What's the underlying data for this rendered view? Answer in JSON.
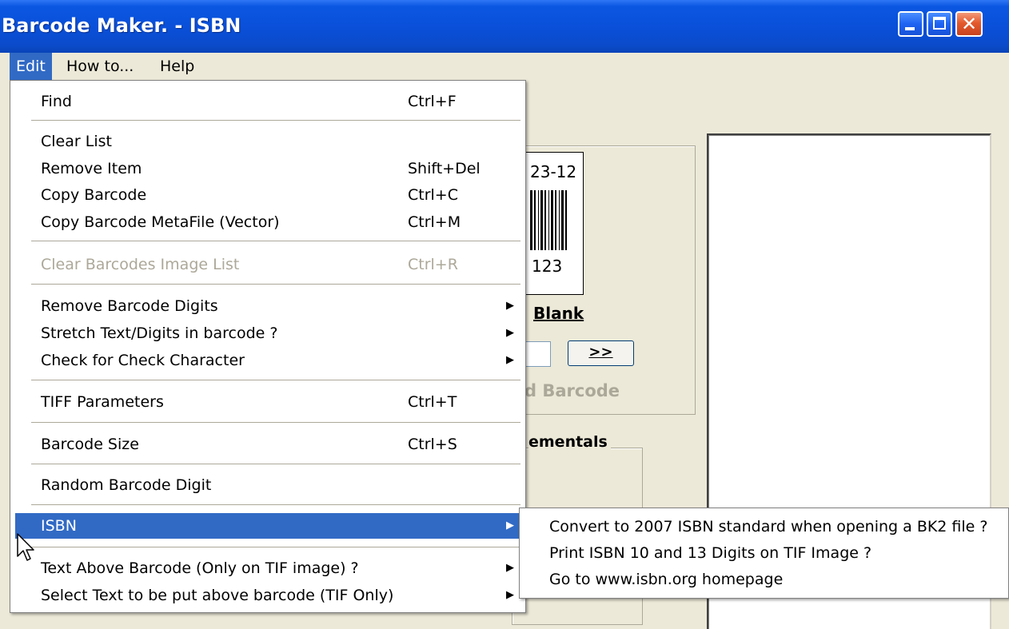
{
  "window": {
    "title": "Barcode Maker. - ISBN",
    "close_glyph": "✕"
  },
  "menubar": {
    "items": [
      {
        "label": "Edit",
        "active": true
      },
      {
        "label": "How to..."
      },
      {
        "label": "Help"
      }
    ]
  },
  "edit_menu": {
    "items": [
      {
        "label": "Find",
        "shortcut": "Ctrl+F"
      },
      {
        "label": "Clear List",
        "shortcut": ""
      },
      {
        "label": "Remove Item",
        "shortcut": "Shift+Del"
      },
      {
        "label": "Copy Barcode",
        "shortcut": "Ctrl+C"
      },
      {
        "label": "Copy Barcode MetaFile (Vector)",
        "shortcut": "Ctrl+M"
      },
      {
        "label": "Clear Barcodes Image List",
        "shortcut": "Ctrl+R",
        "disabled": true
      },
      {
        "label": "Remove Barcode Digits",
        "submenu": true
      },
      {
        "label": "Stretch Text/Digits in barcode ?",
        "submenu": true
      },
      {
        "label": "Check for Check Character",
        "submenu": true
      },
      {
        "label": "TIFF Parameters",
        "shortcut": "Ctrl+T"
      },
      {
        "label": "Barcode Size",
        "shortcut": "Ctrl+S"
      },
      {
        "label": "Random Barcode Digit",
        "shortcut": ""
      },
      {
        "label": "ISBN",
        "submenu": true,
        "highlighted": true
      },
      {
        "label": "Text Above Barcode (Only on TIF image) ?",
        "submenu": true
      },
      {
        "label": "Select Text to be put above barcode (TIF Only)",
        "submenu": true
      }
    ],
    "arrow_glyph": "▶"
  },
  "isbn_submenu": {
    "items": [
      {
        "label": "Convert to 2007 ISBN standard when opening a BK2 file ?"
      },
      {
        "label": "Print ISBN 10 and 13 Digits on TIF Image ?"
      },
      {
        "label": "Go to www.isbn.org homepage"
      }
    ]
  },
  "background": {
    "barcode_top_text": "23-12",
    "barcode_bottom_text": "123",
    "blank_prefix": "",
    "blank_label": "Blank",
    "next_button": ">>",
    "disabled_barcode_text": "d Barcode",
    "supplementals_label": "ementals"
  },
  "colors": {
    "titlebar": "#0A4FD8",
    "highlight": "#316AC5",
    "disabled": "#ACA899",
    "face": "#ECE9D8"
  }
}
